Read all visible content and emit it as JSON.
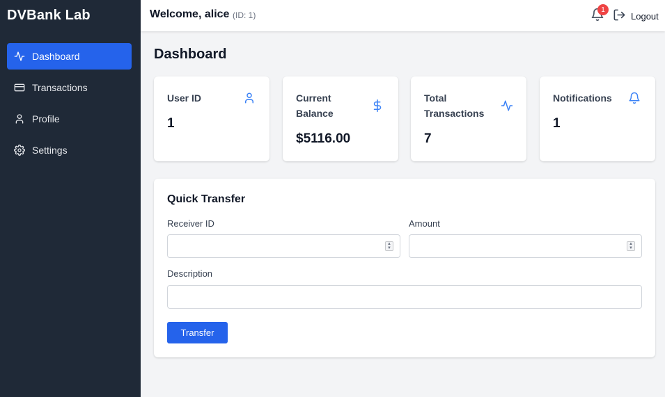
{
  "app": {
    "brand": "DVBank Lab"
  },
  "sidebar": {
    "items": [
      {
        "label": "Dashboard",
        "icon": "activity-icon",
        "active": true
      },
      {
        "label": "Transactions",
        "icon": "credit-card-icon",
        "active": false
      },
      {
        "label": "Profile",
        "icon": "user-icon",
        "active": false
      },
      {
        "label": "Settings",
        "icon": "gear-icon",
        "active": false
      }
    ]
  },
  "header": {
    "welcome": "Welcome, alice",
    "user_id": "(ID: 1)",
    "notification_count": "1",
    "logout_label": "Logout"
  },
  "main": {
    "title": "Dashboard",
    "cards": [
      {
        "label": "User ID",
        "value": "1",
        "icon": "user-icon"
      },
      {
        "label": "Current Balance",
        "value": "$5116.00",
        "icon": "dollar-icon"
      },
      {
        "label": "Total Transactions",
        "value": "7",
        "icon": "activity-icon"
      },
      {
        "label": "Notifications",
        "value": "1",
        "icon": "bell-icon"
      }
    ]
  },
  "transfer": {
    "title": "Quick Transfer",
    "receiver_label": "Receiver ID",
    "receiver_value": "",
    "amount_label": "Amount",
    "amount_value": "",
    "description_label": "Description",
    "description_value": "",
    "submit_label": "Transfer"
  },
  "colors": {
    "sidebar_bg": "#1f2937",
    "accent": "#2563eb",
    "badge": "#ef4444",
    "page_bg": "#f3f4f6"
  }
}
